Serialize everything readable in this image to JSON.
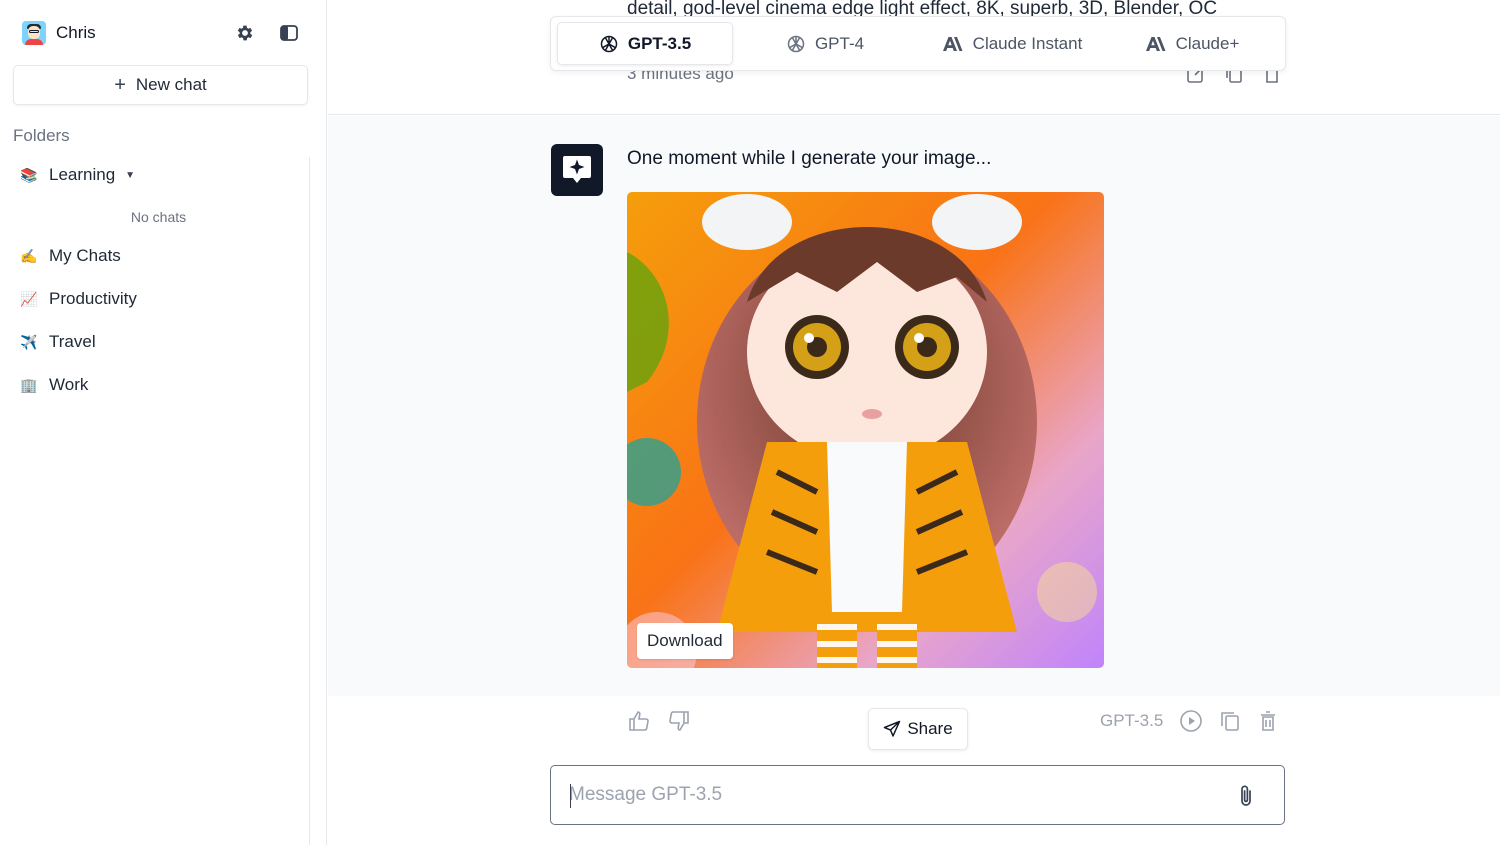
{
  "user": {
    "name": "Chris",
    "avatar_icon": "user-avatar"
  },
  "sidebar": {
    "new_chat_label": "New chat",
    "folders_label": "Folders",
    "folders": [
      {
        "emoji": "📚",
        "label": "Learning",
        "expanded": true,
        "empty_text": "No chats"
      },
      {
        "emoji": "✍️",
        "label": "My Chats"
      },
      {
        "emoji": "📈",
        "label": "Productivity"
      },
      {
        "emoji": "✈️",
        "label": "Travel"
      },
      {
        "emoji": "🏢",
        "label": "Work"
      }
    ]
  },
  "model_tabs": [
    {
      "label": "GPT-3.5",
      "icon": "openai-icon",
      "active": true
    },
    {
      "label": "GPT-4",
      "icon": "openai-icon",
      "active": false
    },
    {
      "label": "Claude Instant",
      "icon": "anthropic-icon",
      "active": false
    },
    {
      "label": "Claude+",
      "icon": "anthropic-icon",
      "active": false
    }
  ],
  "previous_message": {
    "text": "detail, god-level cinema edge light effect, 8K, superb, 3D, Blender, OC",
    "time": "3 minutes ago"
  },
  "current_message": {
    "text": "One moment while I generate your image...",
    "download_label": "Download",
    "share_label": "Share",
    "model_label": "GPT-3.5"
  },
  "composer": {
    "placeholder": "Message GPT-3.5"
  },
  "colors": {
    "accent": "#111827",
    "border": "#e5e7eb",
    "muted": "#9ca3af"
  }
}
